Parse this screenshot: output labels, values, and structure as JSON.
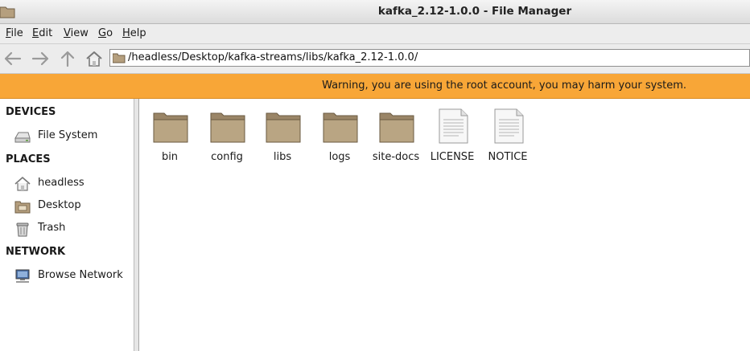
{
  "window": {
    "title": "kafka_2.12-1.0.0 - File Manager"
  },
  "menu": [
    {
      "mnemonic": "F",
      "rest": "ile"
    },
    {
      "mnemonic": "E",
      "rest": "dit"
    },
    {
      "mnemonic": "V",
      "rest": "iew"
    },
    {
      "mnemonic": "G",
      "rest": "o"
    },
    {
      "mnemonic": "H",
      "rest": "elp"
    }
  ],
  "toolbar": {
    "buttons": [
      "back-icon",
      "forward-icon",
      "up-icon",
      "home-icon"
    ],
    "location": "/headless/Desktop/kafka-streams/libs/kafka_2.12-1.0.0/"
  },
  "warning": {
    "text": "Warning, you are using the root account, you may harm your system.",
    "color": "#f8a637"
  },
  "sidebar": {
    "devices_heading": "DEVICES",
    "devices": [
      {
        "label": "File System",
        "icon": "harddisk-icon"
      }
    ],
    "places_heading": "PLACES",
    "places": [
      {
        "label": "headless",
        "icon": "home-folder-icon"
      },
      {
        "label": "Desktop",
        "icon": "desktop-folder-icon"
      },
      {
        "label": "Trash",
        "icon": "trash-icon"
      }
    ],
    "network_heading": "NETWORK",
    "network": [
      {
        "label": "Browse Network",
        "icon": "network-icon"
      }
    ]
  },
  "files": [
    {
      "name": "bin",
      "type": "folder"
    },
    {
      "name": "config",
      "type": "folder"
    },
    {
      "name": "libs",
      "type": "folder"
    },
    {
      "name": "logs",
      "type": "folder"
    },
    {
      "name": "site-docs",
      "type": "folder"
    },
    {
      "name": "LICENSE",
      "type": "document"
    },
    {
      "name": "NOTICE",
      "type": "document"
    }
  ]
}
